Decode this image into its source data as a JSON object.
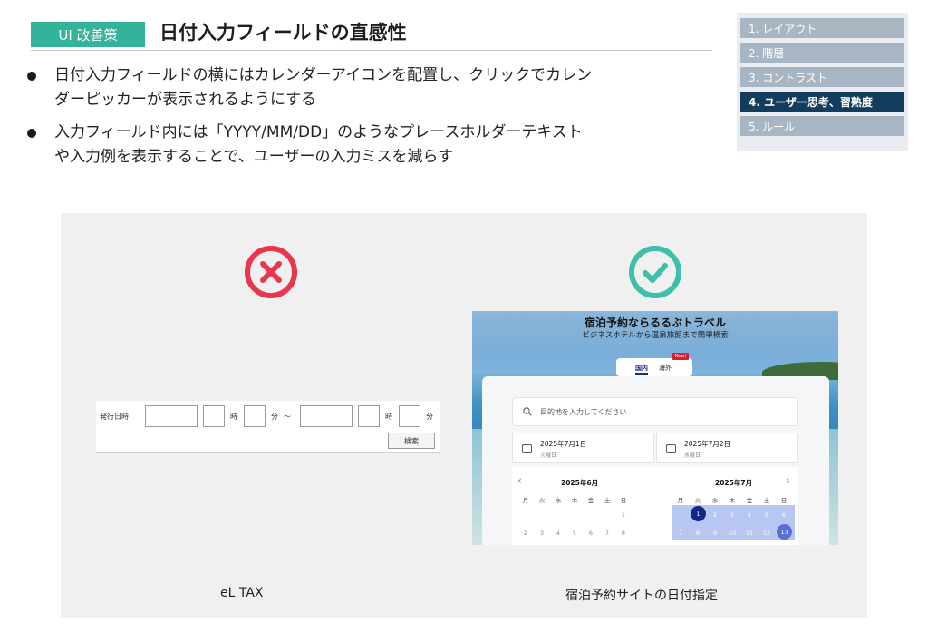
{
  "header": {
    "tag": "UI 改善策",
    "title": "日付入力フィールドの直感性"
  },
  "nav": {
    "items": [
      {
        "label": "1. レイアウト",
        "active": false
      },
      {
        "label": "2. 階層",
        "active": false
      },
      {
        "label": "3. コントラスト",
        "active": false
      },
      {
        "label": "4. ユーザー思考、習熟度",
        "active": true
      },
      {
        "label": "5. ルール",
        "active": false
      }
    ]
  },
  "bullets": [
    {
      "line1": "日付入力フィールドの横にはカレンダーアイコンを配置し、クリックでカレン",
      "line2": "ダーピッカーが表示されるようにする"
    },
    {
      "line1": "入力フィールド内には「YYYY/MM/DD」のようなプレースホルダーテキスト",
      "line2": "や入力例を表示することで、ユーザーの入力ミスを減らす"
    }
  ],
  "bad_example": {
    "icon": "x-circle-icon",
    "label_issue": "発行日時",
    "hour": "時",
    "minute": "分",
    "tilde": "～",
    "search_button": "検索",
    "caption": "eL TAX"
  },
  "good_example": {
    "icon": "check-circle-icon",
    "site_title": "宿泊予約ならるるぶトラベル",
    "site_subtitle": "ビジネスホテルから温泉旅館まで簡単検索",
    "tab_domestic": "国内",
    "tab_overseas": "海外",
    "new_badge": "New!",
    "search_placeholder": "目的地を入力してください",
    "checkin_date": "2025年7月1日",
    "checkin_weekday": "火曜日",
    "checkout_date": "2025年7月2日",
    "checkout_weekday": "水曜日",
    "month_left": "2025年6月",
    "month_right": "2025年7月",
    "weekdays": [
      "月",
      "火",
      "水",
      "木",
      "金",
      "土",
      "日"
    ],
    "caption": "宿泊予約サイトの日付指定"
  },
  "colors": {
    "accent": "#33b39a",
    "nav_active": "#133d5d",
    "nav_inactive": "#a8b6c4",
    "bad": "#e8364c",
    "good": "#3dbfa8"
  }
}
